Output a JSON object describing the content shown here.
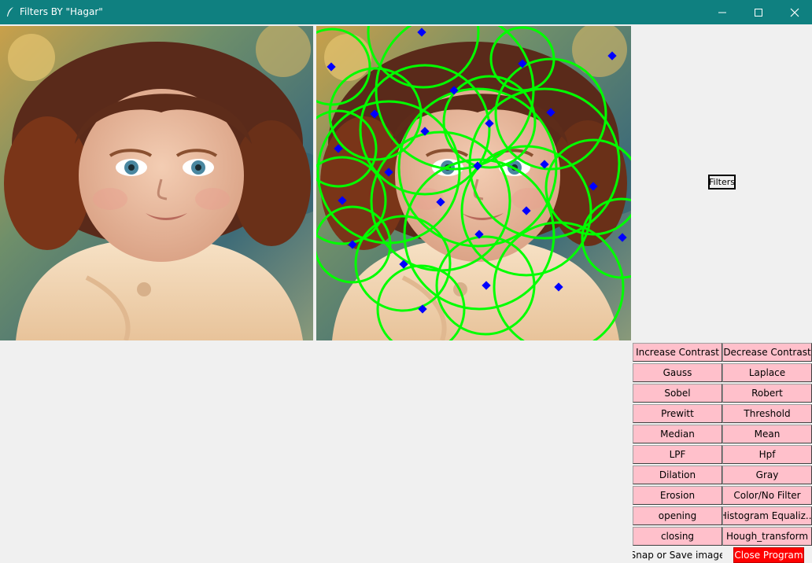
{
  "window": {
    "title": "Filters BY \"Hagar\"",
    "controls": {
      "minimize_icon": "minimize-icon",
      "maximize_icon": "maximize-icon",
      "close_icon": "close-icon"
    }
  },
  "images": {
    "original_alt": "Original photo of a curly-haired child",
    "processed_alt": "Hough transform result: green circles and blue center markers over the photo"
  },
  "filters_label": "Filters",
  "filter_buttons": {
    "increase_contrast": "Increase Contrast",
    "decrease_contrast": "Decrease Contrast",
    "gauss": "Gauss",
    "laplace": "Laplace",
    "sobel": "Sobel",
    "robert": "Robert",
    "prewitt": "Prewitt",
    "threshold": "Threshold",
    "median": "Median",
    "mean": "Mean",
    "lpf": "LPF",
    "hpf": "Hpf",
    "dilation": "Dilation",
    "gray": "Gray",
    "erosion": "Erosion",
    "color_no_filter": "Color/No Filter",
    "opening": "opening",
    "histogram_equalization": "Histogram Equaliz...",
    "closing": "closing",
    "hough_transform": "Hough_transform"
  },
  "actions": {
    "snap": "Snap or Save image",
    "close_program": "Close Program"
  },
  "colors": {
    "titlebar": "#0f8080",
    "button_bg": "#ffc0cb",
    "close_button": "#ff0000",
    "circle_color": "#00ff00",
    "marker_color": "#0000ff"
  }
}
